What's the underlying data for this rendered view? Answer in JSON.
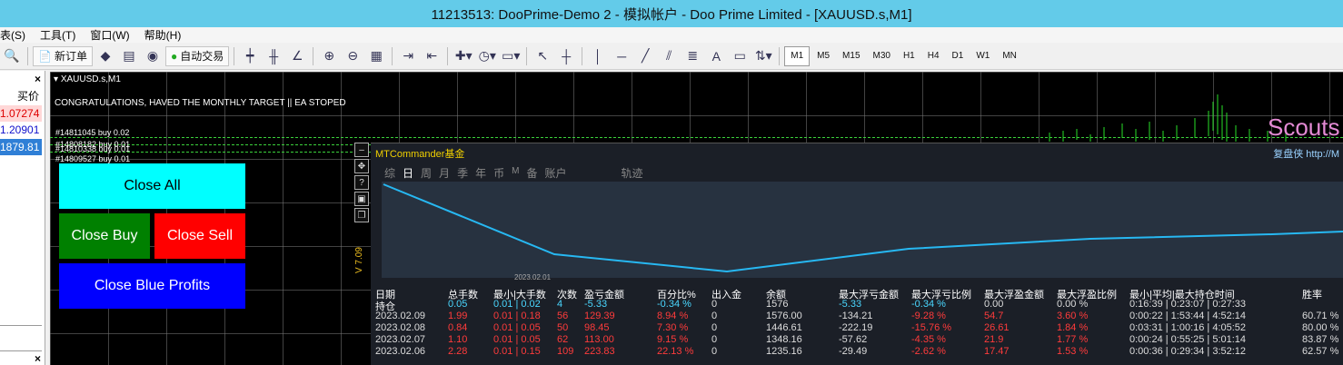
{
  "window": {
    "title": "11213513: DooPrime-Demo 2 - 模拟帐户 - Doo Prime Limited - [XAUUSD.s,M1]"
  },
  "menu": [
    "表(S)",
    "工具(T)",
    "窗口(W)",
    "帮助(H)"
  ],
  "toolbar": {
    "new_order": "新订单",
    "auto_trade": "自动交易",
    "draw_a": "A",
    "timeframes": [
      "M1",
      "M5",
      "M15",
      "M30",
      "H1",
      "H4",
      "D1",
      "W1",
      "MN"
    ],
    "active_timeframe": "M1"
  },
  "market_watch": {
    "close": "×",
    "bid_header": "买价",
    "rows": [
      "1.07274",
      "1.20901",
      "1879.81"
    ]
  },
  "chart": {
    "symbol": "XAUUSD.s,M1",
    "message": "CONGRATULATIONS, HAVED THE MONTHLY TARGET || EA STOPED",
    "orders": [
      "#14811045 buy 0.02",
      "#14808182 buy 0.01",
      "#14810338 buy 0.01",
      "#14809527 buy 0.01"
    ],
    "watermark": "Scouts",
    "rotated_label": "V 7.09",
    "buttons": {
      "close_all": "Close All",
      "close_buy": "Close Buy",
      "close_sell": "Close Sell",
      "close_blue_profits": "Close Blue Profits"
    }
  },
  "commander": {
    "title": "MTCommander基金",
    "right_link": "复盘侠 http://M",
    "tabs": [
      "综",
      "日",
      "周",
      "月",
      "季",
      "年",
      "币",
      "M",
      "备",
      "账户",
      "轨迹"
    ],
    "active_tab": "日",
    "graph_label": "2023.02.01",
    "columns": [
      "日期",
      "总手数",
      "最小|大手数",
      "次数",
      "盈亏金额",
      "百分比%",
      "出入金",
      "余额",
      "最大浮亏金额",
      "最大浮亏比例",
      "最大浮盈金额",
      "最大浮盈比例",
      "最小|平均|最大持仓时间",
      "胜率"
    ],
    "position_row": [
      "持仓",
      "0.05",
      "0.01 | 0.02",
      "4",
      "-5.33",
      "-0.34 %",
      "0",
      "1576",
      "-5.33",
      "-0.34 %",
      "0.00",
      "0.00 %",
      "0:16:39 | 0:23:07 | 0:27:33",
      ""
    ],
    "rows": [
      [
        "2023.02.09",
        "1.99",
        "0.01 | 0.18",
        "56",
        "129.39",
        "8.94 %",
        "0",
        "1576.00",
        "-134.21",
        "-9.28 %",
        "54.7",
        "3.60 %",
        "0:00:22 | 1:53:44 | 4:52:14",
        "60.71 %"
      ],
      [
        "2023.02.08",
        "0.84",
        "0.01 | 0.05",
        "50",
        "98.45",
        "7.30 %",
        "0",
        "1446.61",
        "-222.19",
        "-15.76 %",
        "26.61",
        "1.84 %",
        "0:03:31 | 1:00:16 | 4:05:52",
        "80.00 %"
      ],
      [
        "2023.02.07",
        "1.10",
        "0.01 | 0.05",
        "62",
        "113.00",
        "9.15 %",
        "0",
        "1348.16",
        "-57.62",
        "-4.35 %",
        "21.9",
        "1.77 %",
        "0:00:24 | 0:55:25 | 5:01:14",
        "83.87 %"
      ],
      [
        "2023.02.06",
        "2.28",
        "0.01 | 0.15",
        "109",
        "223.83",
        "22.13 %",
        "0",
        "1235.16",
        "-29.49",
        "-2.62 %",
        "17.47",
        "1.53 %",
        "0:00:36 | 0:29:34 | 3:52:12",
        "62.57 %"
      ]
    ]
  }
}
